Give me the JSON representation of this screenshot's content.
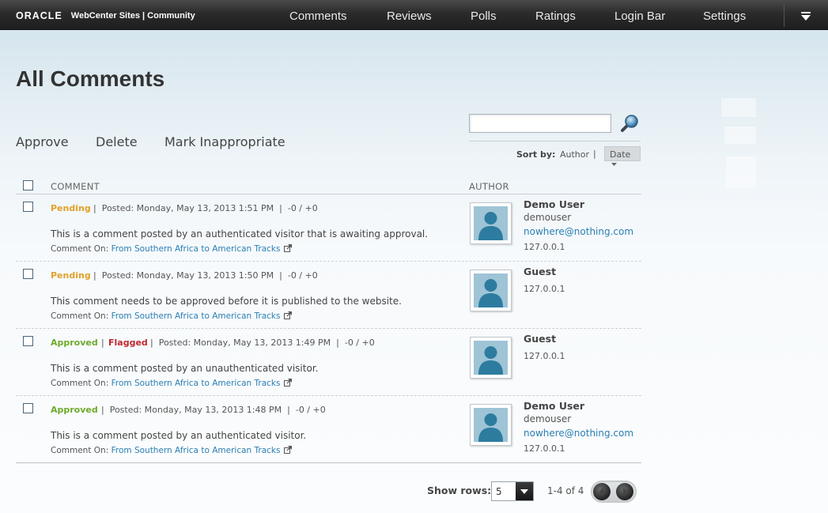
{
  "header": {
    "logo": "ORACLE",
    "product": "WebCenter Sites | Community",
    "nav": [
      "Comments",
      "Reviews",
      "Polls",
      "Ratings",
      "Login Bar",
      "Settings"
    ]
  },
  "page": {
    "title": "All Comments",
    "actions": [
      "Approve",
      "Delete",
      "Mark Inappropriate"
    ]
  },
  "search": {
    "value": "",
    "placeholder": ""
  },
  "sort": {
    "label": "Sort by:",
    "author": "Author",
    "separator": "|",
    "date": "Date"
  },
  "table": {
    "col_comment": "COMMENT",
    "col_author": "AUTHOR",
    "rows": [
      {
        "status": "Pending",
        "flag": "",
        "meta": "Posted: Monday, May 13, 2013 1:51 PM",
        "votes": "-0 / +0",
        "text": "This is a comment posted by an authenticated visitor that is awaiting approval.",
        "comment_on_label": "Comment On:",
        "comment_on_link": "From Southern Africa to American Tracks",
        "author_name": "Demo User",
        "author_user": "demouser",
        "author_email": "nowhere@nothing.com",
        "author_ip": "127.0.0.1"
      },
      {
        "status": "Pending",
        "flag": "",
        "meta": "Posted: Monday, May 13, 2013 1:50 PM",
        "votes": "-0 / +0",
        "text": "This comment needs to be approved before it is published to the website.",
        "comment_on_label": "Comment On:",
        "comment_on_link": "From Southern Africa to American Tracks",
        "author_name": "Guest",
        "author_user": "",
        "author_email": "",
        "author_ip": "127.0.0.1"
      },
      {
        "status": "Approved",
        "flag": "Flagged",
        "meta": "Posted: Monday, May 13, 2013 1:49 PM",
        "votes": "-0 / +0",
        "text": "This is a comment posted by an unauthenticated visitor.",
        "comment_on_label": "Comment On:",
        "comment_on_link": "From Southern Africa to American Tracks",
        "author_name": "Guest",
        "author_user": "",
        "author_email": "",
        "author_ip": "127.0.0.1"
      },
      {
        "status": "Approved",
        "flag": "",
        "meta": "Posted: Monday, May 13, 2013 1:48 PM",
        "votes": "-0 / +0",
        "text": "This is a comment posted by an authenticated visitor.",
        "comment_on_label": "Comment On:",
        "comment_on_link": "From Southern Africa to American Tracks",
        "author_name": "Demo User",
        "author_user": "demouser",
        "author_email": "nowhere@nothing.com",
        "author_ip": "127.0.0.1"
      }
    ]
  },
  "pagination": {
    "show_rows_label": "Show rows:",
    "rows_value": "5",
    "count": "1-4 of 4"
  },
  "colors": {
    "pending": "#e0a12a",
    "approved": "#6cab2c",
    "flagged": "#c0282d",
    "link": "#2b7fb2",
    "topbar": "#2b2b2b"
  },
  "icons": [
    "search-icon",
    "menu-arrow-icon",
    "external-link-icon",
    "avatar-placeholder-icon",
    "chevron-down-icon",
    "prev-page-icon",
    "next-page-icon"
  ]
}
